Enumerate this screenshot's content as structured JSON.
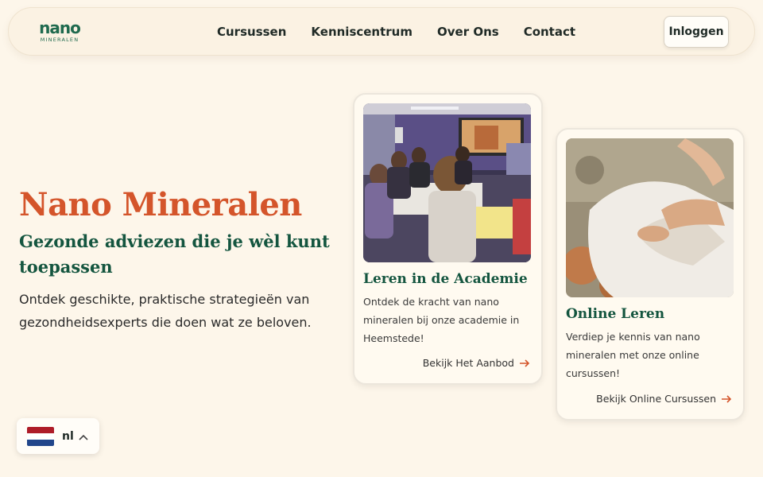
{
  "brand": {
    "logo_word": "nano",
    "logo_sub": "MINERALEN"
  },
  "nav": {
    "links": [
      "Cursussen",
      "Kenniscentrum",
      "Over Ons",
      "Contact"
    ],
    "login_label": "Inloggen"
  },
  "hero": {
    "title": "Nano Mineralen",
    "subtitle": "Gezonde adviezen die je wèl kunt toepassen",
    "description": "Ontdek geschikte, praktische strategieën van gezondheidsexperts die doen wat ze beloven."
  },
  "cards": [
    {
      "title": "Leren in de Academie",
      "text": "Ontdek de kracht van nano mineralen bij onze academie in Heemstede!",
      "link": "Bekijk Het Aanbod"
    },
    {
      "title": "Online Leren",
      "text": "Verdiep je kennis van nano mineralen met onze online cursussen!",
      "link": "Bekijk Online Cursussen"
    }
  ],
  "language": {
    "code": "nl",
    "flag_colors": [
      "#ae1c28",
      "#ffffff",
      "#21468b"
    ]
  },
  "colors": {
    "accent_orange": "#d4552b",
    "brand_green": "#14553f",
    "background": "#fdf6ea"
  },
  "icons": {
    "link_arrow": "arrow-right-icon",
    "lang_chevron": "chevron-up-icon"
  }
}
